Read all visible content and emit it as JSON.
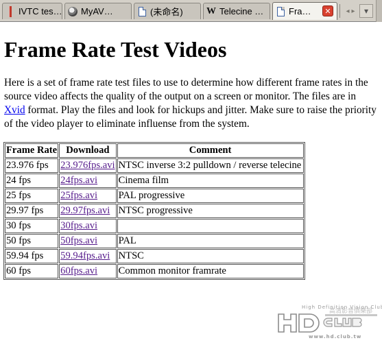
{
  "tabs": [
    {
      "label": "IVTC tes…",
      "icon": "red-bar-icon"
    },
    {
      "label": "MyAV…",
      "icon": "avatar-icon"
    },
    {
      "label": "(未命名)",
      "icon": "page-icon"
    },
    {
      "label": "Telecine …",
      "icon": "wikipedia-icon"
    },
    {
      "label": "Fra…",
      "icon": "page-icon",
      "active": true
    }
  ],
  "tabstrip": {
    "close_glyph": "✕",
    "scroll_left_glyph": "◂",
    "scroll_right_glyph": "▸",
    "menu_glyph": "▾"
  },
  "page": {
    "title": "Frame Rate Test Videos",
    "intro": {
      "before_link": "Here is a set of frame rate test files to use to determine how different frame rates in the source video affects the quality of the output on a screen or monitor. The files are in ",
      "link_text": "Xvid",
      "after_link": " format. Play the files and look for hickups and jitter. Make sure to raise the priority of the video player to eliminate influense from the system."
    },
    "table": {
      "headers": {
        "frame_rate": "Frame Rate",
        "download": "Download",
        "comment": "Comment"
      },
      "rows": [
        {
          "rate": "23.976 fps",
          "file": "23.976fps.avi",
          "comment": "NTSC inverse 3:2 pulldown / reverse telecine"
        },
        {
          "rate": "24 fps",
          "file": "24fps.avi",
          "comment": "Cinema film"
        },
        {
          "rate": "25 fps",
          "file": "25fps.avi",
          "comment": "PAL progressive"
        },
        {
          "rate": "29.97 fps",
          "file": "29.97fps.avi",
          "comment": "NTSC progressive"
        },
        {
          "rate": "30 fps",
          "file": "30fps.avi",
          "comment": ""
        },
        {
          "rate": "50 fps",
          "file": "50fps.avi",
          "comment": "PAL"
        },
        {
          "rate": "59.94 fps",
          "file": "59.94fps.avi",
          "comment": "NTSC"
        },
        {
          "rate": "60 fps",
          "file": "60fps.avi",
          "comment": "Common monitor framrate"
        }
      ]
    }
  },
  "watermark": {
    "caption": "High Definition Vision Club",
    "logo_text": "HDCLUB",
    "cn_text": "高清影音俱樂部",
    "url": "www.hd.club.tw"
  },
  "colors": {
    "link": "#0000ee",
    "visited_link": "#551a8b",
    "tab_close": "#d9412f"
  }
}
